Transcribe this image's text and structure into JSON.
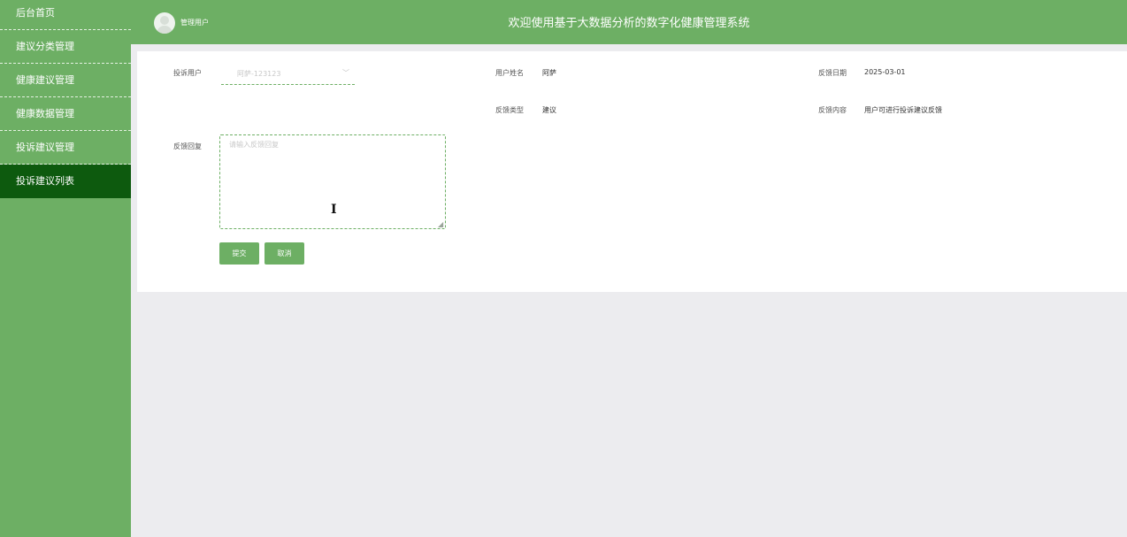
{
  "sidebar": {
    "items": [
      {
        "label": "后台首页"
      },
      {
        "label": "建议分类管理"
      },
      {
        "label": "健康建议管理"
      },
      {
        "label": "健康数据管理"
      },
      {
        "label": "投诉建议管理"
      },
      {
        "label": "投诉建议列表"
      }
    ],
    "active_index": 5
  },
  "header": {
    "user_name": "管理用户",
    "title": "欢迎使用基于大数据分析的数字化健康管理系统"
  },
  "form": {
    "complaint_user_label": "投诉用户",
    "complaint_user_value": "阿萨-123123",
    "user_name_label": "用户姓名",
    "user_name_value": "阿萨",
    "feedback_date_label": "反馈日期",
    "feedback_date_value": "2025-03-01",
    "feedback_type_label": "反馈类型",
    "feedback_type_value": "建议",
    "feedback_content_label": "反馈内容",
    "feedback_content_value": "用户可进行投诉建议反馈",
    "reply_label": "反馈回复",
    "reply_placeholder": "请输入反馈回复",
    "reply_value": "",
    "submit_label": "提交",
    "cancel_label": "取消"
  },
  "colors": {
    "primary": "#6daf64",
    "active": "#0d5a0e",
    "background": "#ececef"
  },
  "icons": {
    "avatar": "user-avatar-icon",
    "select_arrow": "chevron-down-icon",
    "resize_grip": "resize-grip-icon",
    "cursor": "text-cursor-icon"
  }
}
